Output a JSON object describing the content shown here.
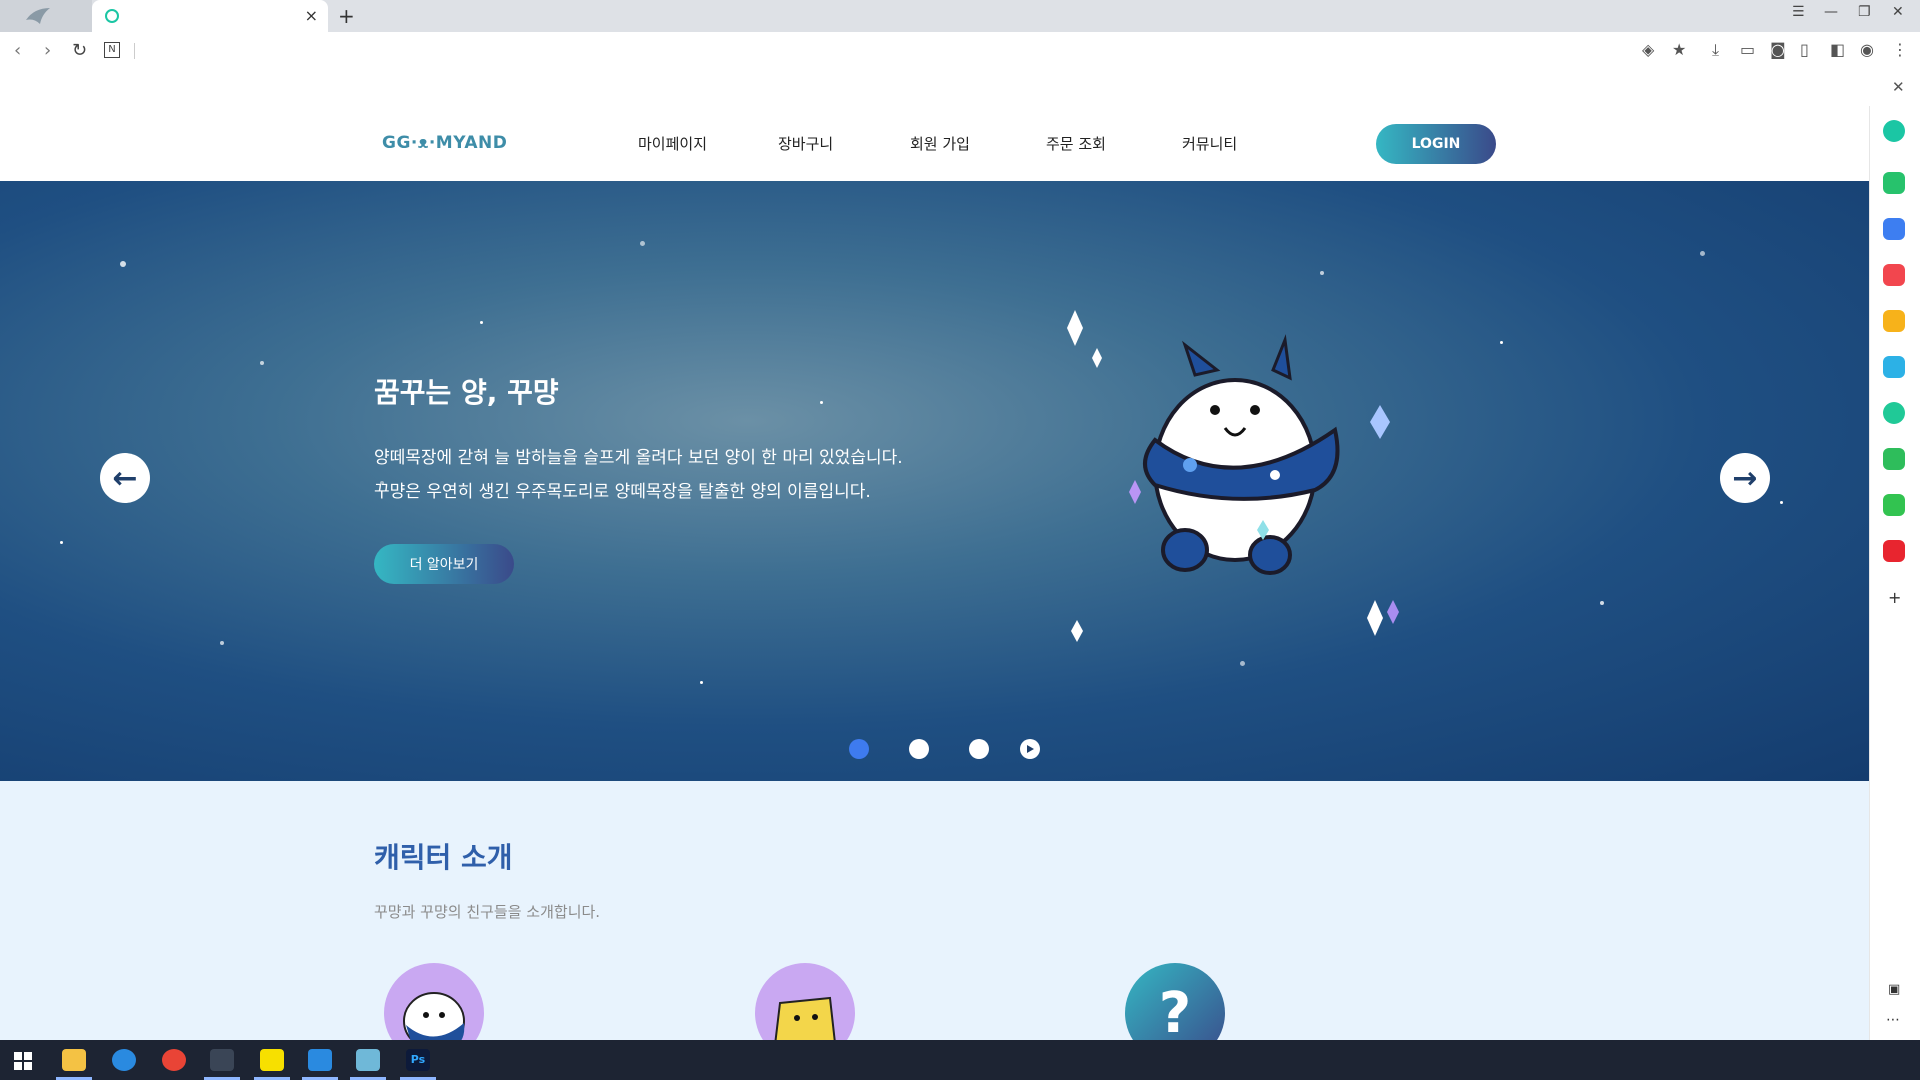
{
  "browser": {
    "tab_title": "",
    "tab_close": "×",
    "new_tab": "+"
  },
  "site": {
    "logo": "GG·ᴥ·MYAND",
    "menu": [
      "마이페이지",
      "장바구니",
      "회원 가입",
      "주문 조회",
      "커뮤니티"
    ],
    "login_label": "LOGIN"
  },
  "hero": {
    "title": "꿈꾸는 양, 꾸먕",
    "desc_line1": "양떼목장에 갇혀 늘 밤하늘을 슬프게 올려다 보던 양이 한 마리 있었습니다.",
    "desc_line2": "꾸먕은 우연히 생긴 우주목도리로 양떼목장을 탈출한 양의 이름입니다.",
    "cta_label": "더 알아보기",
    "prev_arrow": "←",
    "next_arrow": "→"
  },
  "intro": {
    "title": "캐릭터 소개",
    "subtitle": "꾸먕과 꾸먕의 친구들을 소개합니다.",
    "mystery_mark": "?"
  },
  "colors": {
    "accent_start": "#35b7c3",
    "accent_end": "#3a4a8a",
    "section_title": "#2f5faa",
    "section_bg": "#e8f3fd"
  }
}
